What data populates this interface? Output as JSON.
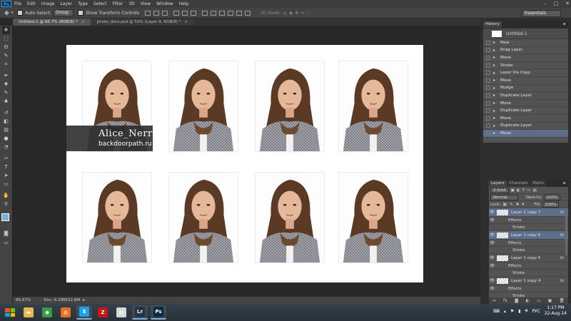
{
  "app": {
    "logo": "Ps"
  },
  "menus": [
    "File",
    "Edit",
    "Image",
    "Layer",
    "Type",
    "Select",
    "Filter",
    "3D",
    "View",
    "Window",
    "Help"
  ],
  "window_controls": [
    "–",
    "□",
    "✕"
  ],
  "options": {
    "tool_icon": "move-icon",
    "auto_select_label": "Auto-Select:",
    "auto_select_value": "Group",
    "show_transform_label": "Show Transform Controls",
    "mode_3d_label": "3D Mode:",
    "workspace": "Essentials"
  },
  "tabs": [
    {
      "label": "Untitled-1 @ 66.7% (RGB/8) *",
      "active": true
    },
    {
      "label": "photo_docs.psd @ 50% (Layer 9, RGB/8) *",
      "active": false
    }
  ],
  "tools": [
    "move-icon",
    "marquee-icon",
    "lasso-icon",
    "quick-select-icon",
    "crop-icon",
    "eyedropper-icon",
    "healing-icon",
    "brush-icon",
    "stamp-icon",
    "history-brush-icon",
    "eraser-icon",
    "gradient-icon",
    "blur-icon",
    "dodge-icon",
    "pen-icon",
    "type-icon",
    "path-select-icon",
    "shape-icon",
    "hand-icon",
    "zoom-icon"
  ],
  "tool_glyphs": [
    "✥",
    "⬚",
    "ʘ",
    "✎",
    "⌗",
    "✒",
    "✚",
    "✎",
    "♣",
    "↺",
    "◧",
    "▤",
    "●",
    "◔",
    "✑",
    "T",
    "➤",
    "▭",
    "✋",
    "⚲"
  ],
  "colors": {
    "foreground": "#7ab2de",
    "background": "#ffffff",
    "accent_selected": "#5c6e8a"
  },
  "watermark": {
    "title": "Alice_Nerr",
    "url": "backdoorpath.ru"
  },
  "status": {
    "zoom": "66.67%",
    "doc": "Doc: 6.18M/32.8M"
  },
  "history": {
    "title": "History",
    "snapshot": "Untitled-1",
    "items": [
      "New",
      "Drag Layer",
      "Move",
      "Stroke",
      "Layer Via Copy",
      "Move",
      "Nudge",
      "Duplicate Layer",
      "Move",
      "Duplicate Layer",
      "Move",
      "Duplicate Layer",
      "Move"
    ],
    "selected_index": 12
  },
  "layers_panel": {
    "tabs": [
      "Layers",
      "Channels",
      "Paths"
    ],
    "kind": "Kind",
    "blend": "Normal",
    "opacity_label": "Opacity:",
    "opacity": "100%",
    "lock_label": "Lock:",
    "fill_label": "Fill:",
    "fill": "100%",
    "effects_label": "Effects",
    "stroke_label": "Stroke",
    "fx_label": "fx",
    "layers": [
      {
        "name": "Layer 1 copy 7",
        "selected": true
      },
      {
        "name": "Layer 1 copy 6",
        "selected": true
      },
      {
        "name": "Layer 1 copy 5",
        "selected": false
      },
      {
        "name": "Layer 1 copy 4",
        "selected": false
      }
    ]
  },
  "taskbar": {
    "apps": [
      {
        "name": "file-explorer-icon",
        "glyph": "▬",
        "color": "#e8b84a",
        "running": false
      },
      {
        "name": "chrome-icon",
        "glyph": "◉",
        "color": "#3c9a47",
        "running": false
      },
      {
        "name": "firefox-icon",
        "glyph": "◍",
        "color": "#e76f1e",
        "running": false
      },
      {
        "name": "skype-icon",
        "glyph": "S",
        "color": "#1da1e2",
        "running": true
      },
      {
        "name": "filezilla-icon",
        "glyph": "Z",
        "color": "#c4161c",
        "running": false
      },
      {
        "name": "files-icon",
        "glyph": "▤",
        "color": "#d8d8d8",
        "running": false
      },
      {
        "name": "lightroom-icon",
        "glyph": "Lr",
        "color": "#233444",
        "running": true
      },
      {
        "name": "photoshop-icon",
        "glyph": "Ps",
        "color": "#0a2b48",
        "running": true
      }
    ],
    "lang": "РУС",
    "time": "1:17 PM",
    "date": "22-Aug-14"
  }
}
